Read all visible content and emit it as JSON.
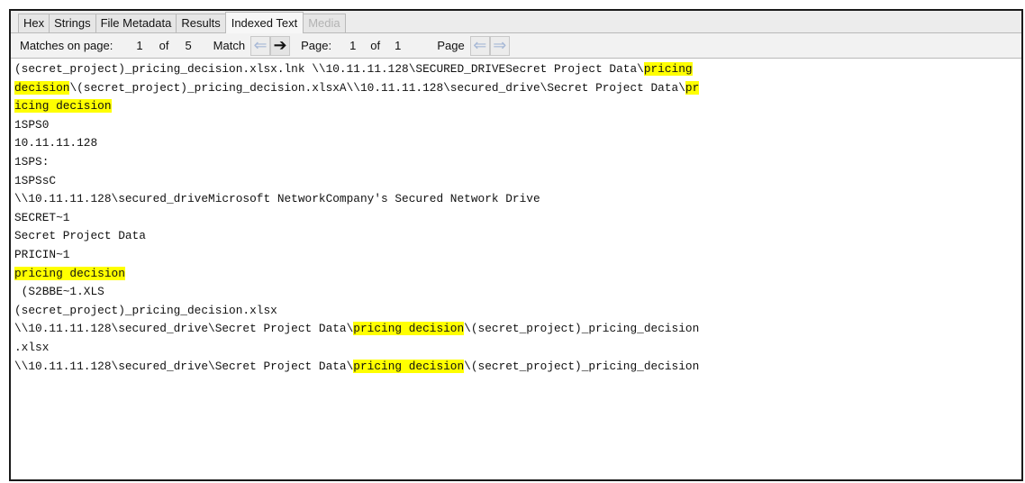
{
  "tabs": [
    {
      "label": "Hex"
    },
    {
      "label": "Strings"
    },
    {
      "label": "File Metadata"
    },
    {
      "label": "Results"
    },
    {
      "label": "Indexed Text"
    },
    {
      "label": "Media"
    }
  ],
  "toolbar": {
    "matches_label": "Matches on page:",
    "match_current": "1",
    "of_label": "of",
    "match_total": "5",
    "match_label": "Match",
    "page_label": "Page:",
    "page_current": "1",
    "page_of_label": "of",
    "page_total": "1",
    "page_label2": "Page"
  },
  "text_lines": [
    [
      {
        "t": "(secret_project)_pricing_decision.xlsx.lnk \\\\10.11.11.128\\SECURED_DRIVESecret Project Data\\"
      },
      {
        "t": "pricing",
        "hl": true
      }
    ],
    [
      {
        "t": "decision",
        "hl": true
      },
      {
        "t": "\\(secret_project)_pricing_decision.xlsxA\\\\10.11.11.128\\secured_drive\\Secret Project Data\\"
      },
      {
        "t": "pr",
        "hl": true
      }
    ],
    [
      {
        "t": "icing decision",
        "hl": true
      }
    ],
    [
      {
        "t": "1SPS0"
      }
    ],
    [
      {
        "t": "10.11.11.128"
      }
    ],
    [
      {
        "t": "1SPS:"
      }
    ],
    [
      {
        "t": "1SPSsC"
      }
    ],
    [
      {
        "t": "\\\\10.11.11.128\\secured_driveMicrosoft NetworkCompany's Secured Network Drive"
      }
    ],
    [
      {
        "t": "SECRET~1"
      }
    ],
    [
      {
        "t": "Secret Project Data"
      }
    ],
    [
      {
        "t": "PRICIN~1"
      }
    ],
    [
      {
        "t": "pricing decision",
        "hl": true
      }
    ],
    [
      {
        "t": " (S2BBE~1.XLS"
      }
    ],
    [
      {
        "t": "(secret_project)_pricing_decision.xlsx"
      }
    ],
    [
      {
        "t": "\\\\10.11.11.128\\secured_drive\\Secret Project Data\\"
      },
      {
        "t": "pricing decision",
        "hl": true
      },
      {
        "t": "\\(secret_project)_pricing_decision"
      }
    ],
    [
      {
        "t": ".xlsx"
      }
    ],
    [
      {
        "t": "\\\\10.11.11.128\\secured_drive\\Secret Project Data\\"
      },
      {
        "t": "pricing decision",
        "hl": true
      },
      {
        "t": "\\(secret_project)_pricing_decision"
      }
    ]
  ],
  "colors": {
    "highlight": "#ffff00",
    "text": "#111111",
    "tab_disabled": "#b3b3b3",
    "frame_border": "#1a1a1a"
  },
  "icons": {
    "prev": "arrow-left-icon",
    "next": "arrow-right-icon"
  }
}
